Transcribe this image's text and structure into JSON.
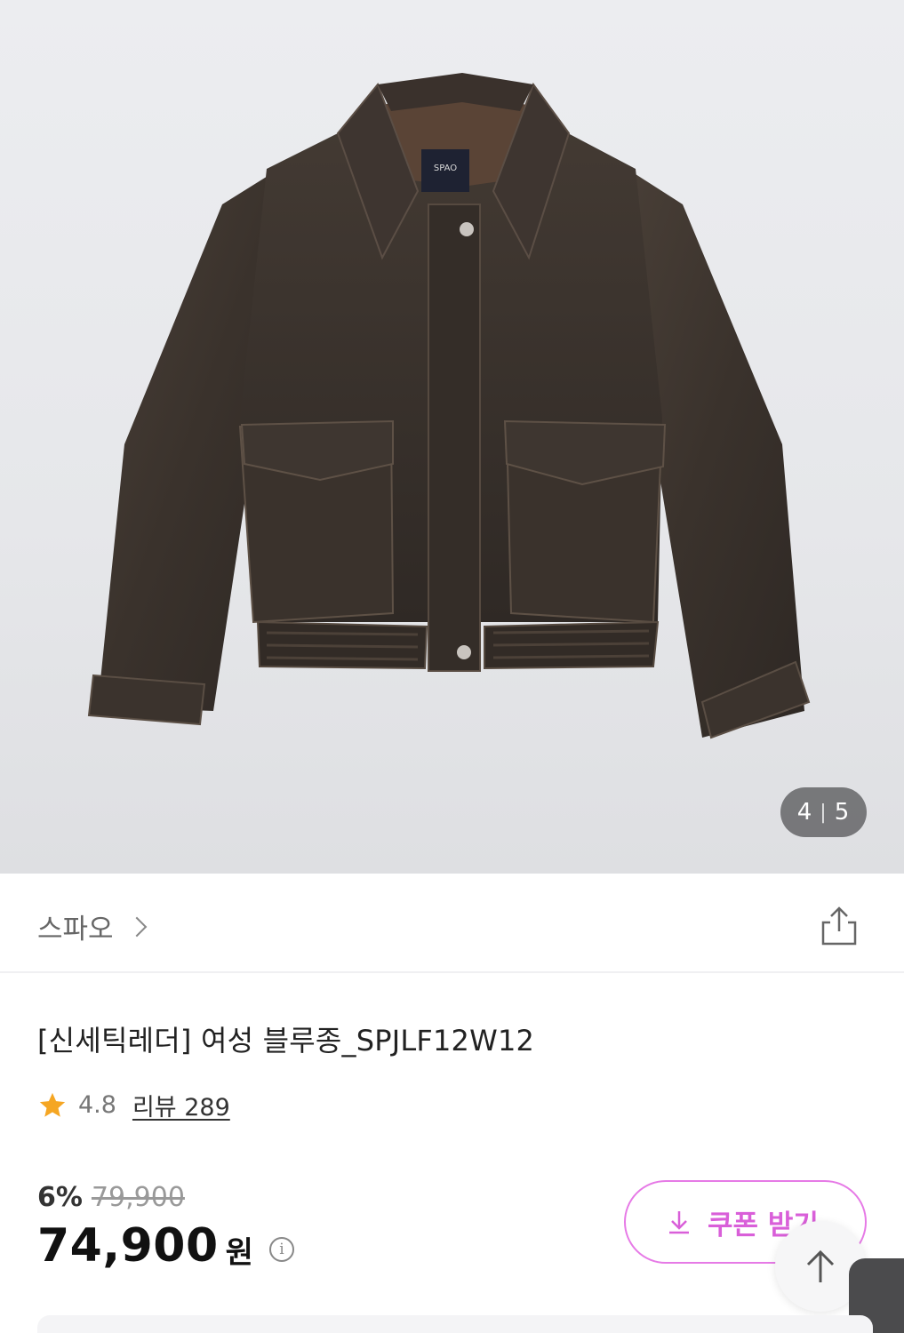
{
  "gallery": {
    "current": "4",
    "separator": "|",
    "total": "5",
    "label_brand": "SPAO"
  },
  "brand": {
    "name": "스파오",
    "chevron_icon": "chevron-right-icon",
    "share_icon": "share-icon"
  },
  "product": {
    "title": "[신세틱레더] 여성 블루종_SPJLF12W12",
    "rating": "4.8",
    "review_label": "리뷰 289"
  },
  "price": {
    "discount_rate": "6%",
    "original": "79,900",
    "final": "74,900",
    "unit": "원",
    "info_icon": "i"
  },
  "coupon": {
    "label": "쿠폰 받기",
    "icon": "download-icon"
  },
  "scroll_top": {
    "icon": "arrow-up-icon"
  },
  "colors": {
    "accent": "#d95fd9",
    "star": "#f5a623"
  }
}
